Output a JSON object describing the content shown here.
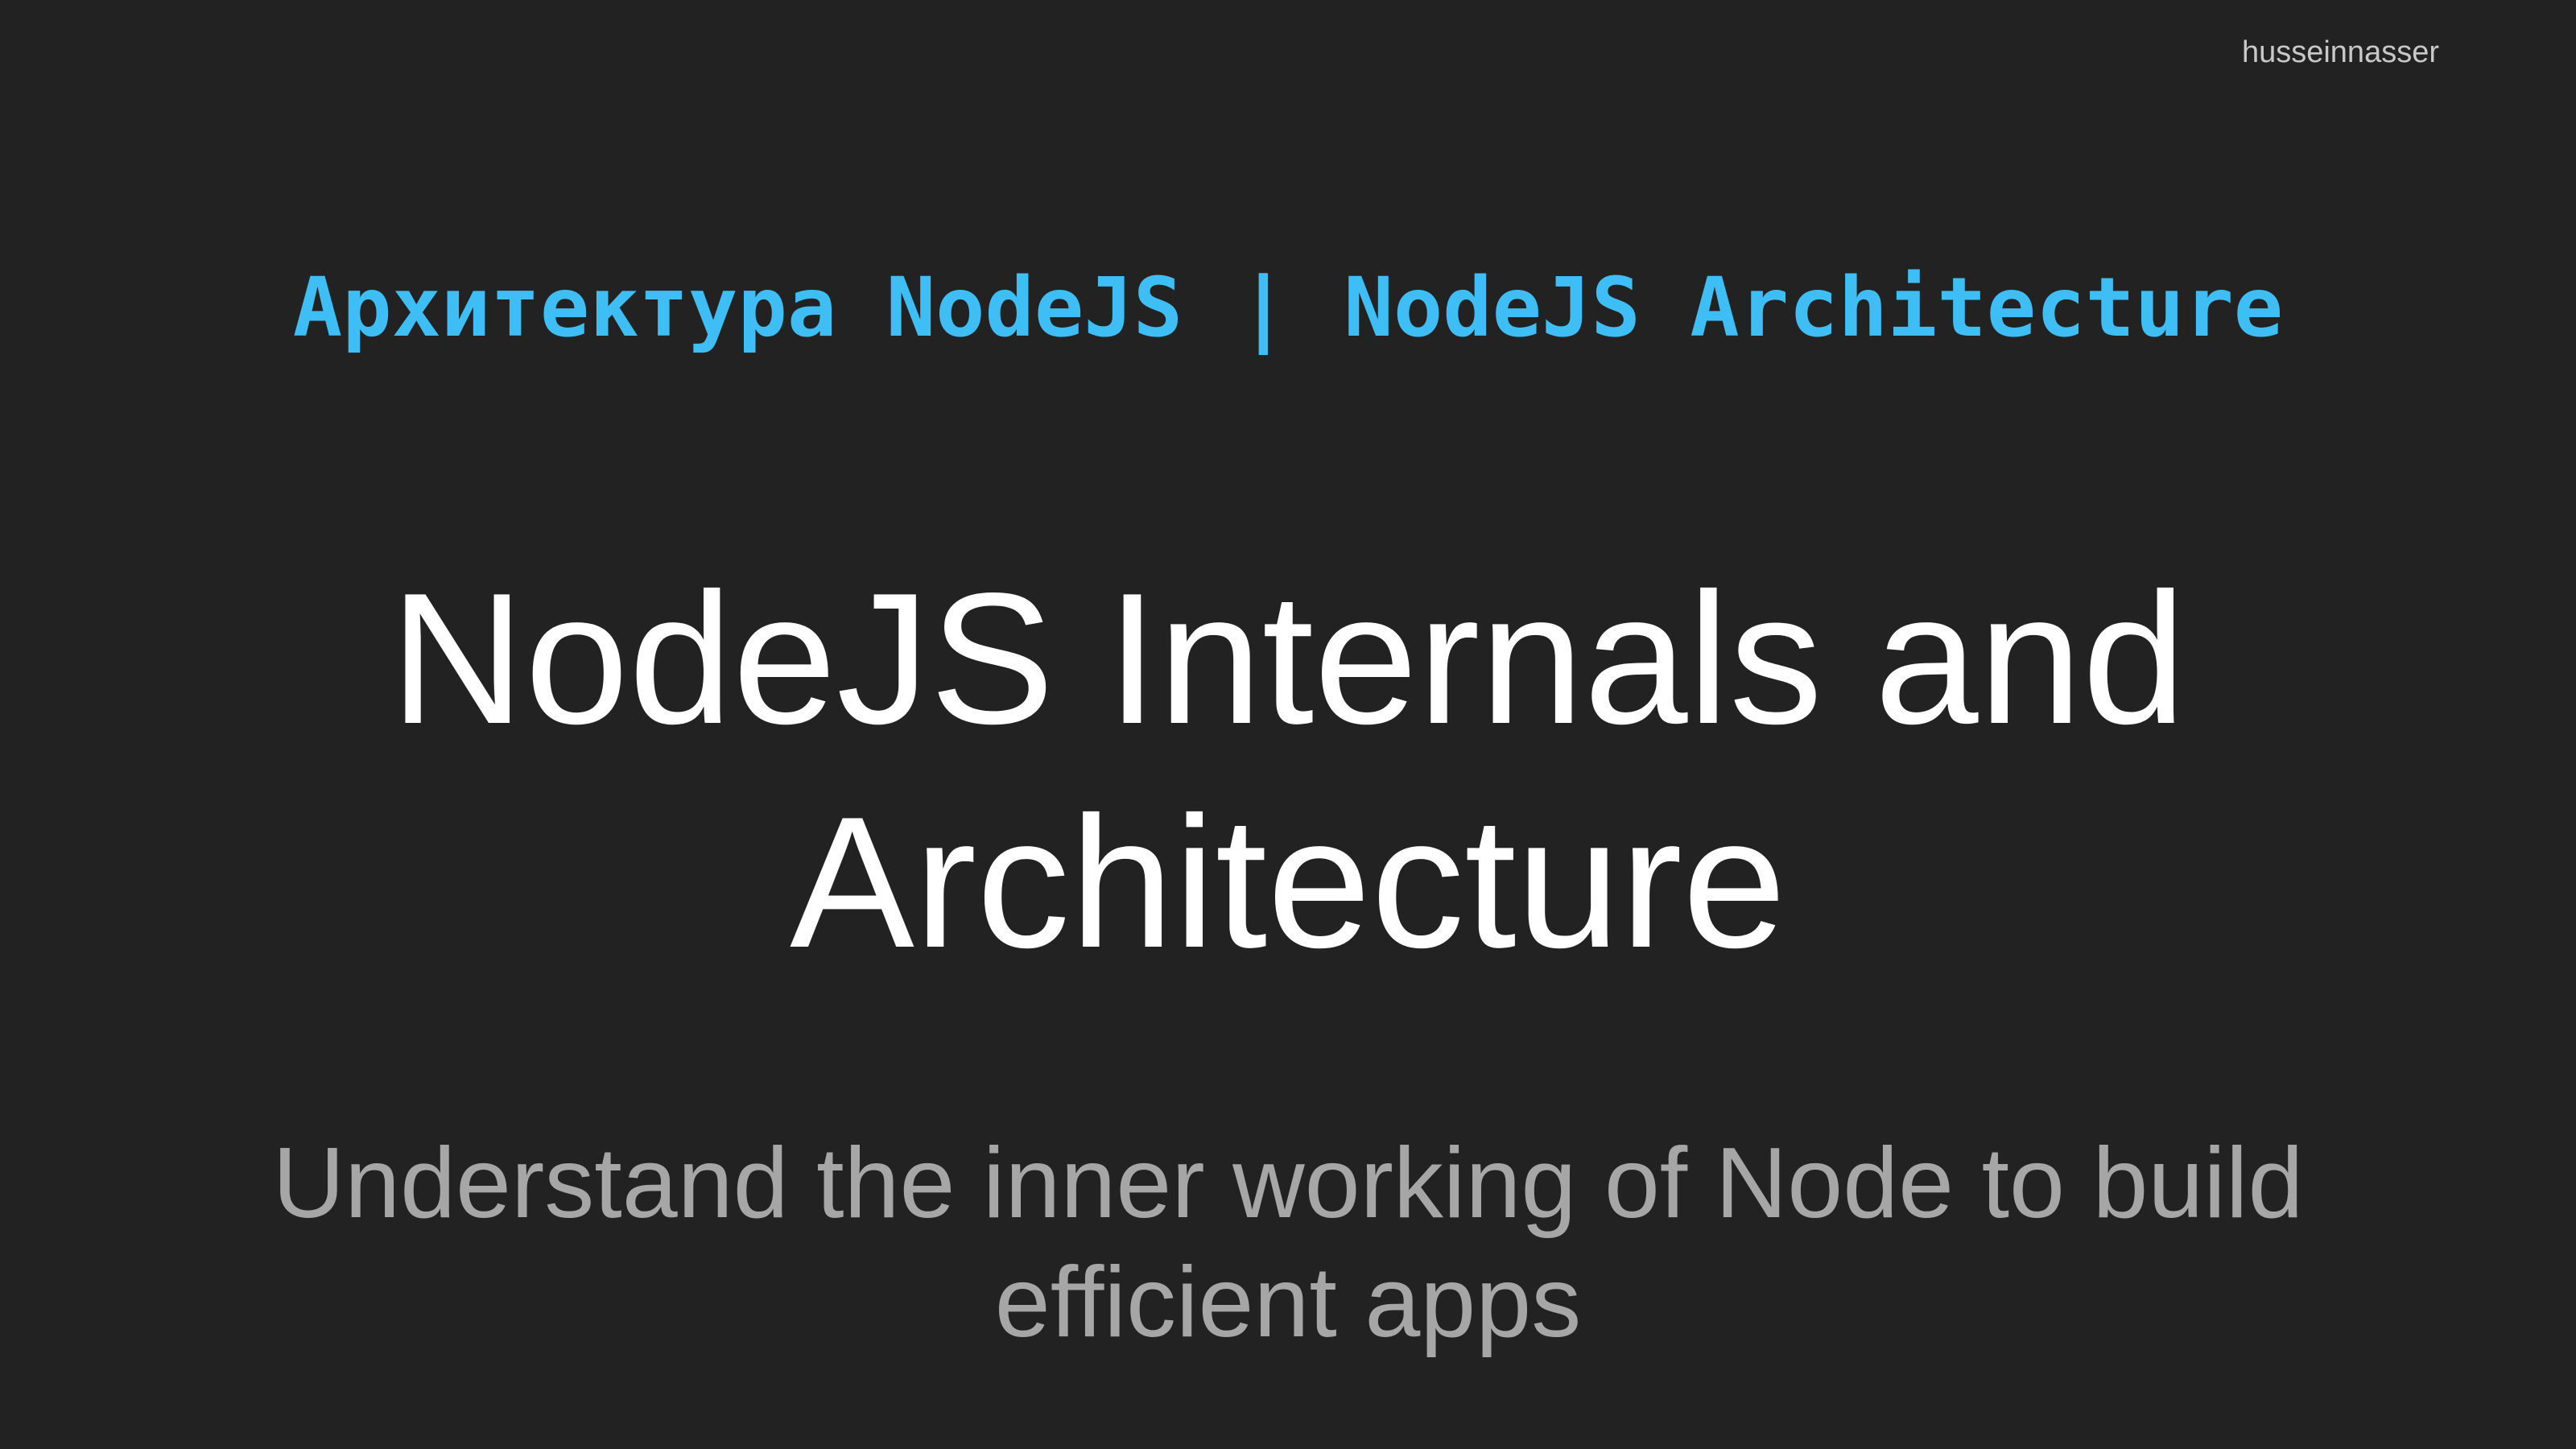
{
  "slide": {
    "watermark": "husseinnasser",
    "banner": {
      "russian": "Архитектура NodeJS",
      "separator": "|",
      "english": "NodeJS Architecture",
      "color": "#3fbef5"
    },
    "heading": {
      "line1": "NodeJS Internals and",
      "line2": "Architecture"
    },
    "subtitle": {
      "line1": "Understand the inner working of Node to build",
      "line2": "efficient apps"
    },
    "background_color": "#222222"
  }
}
